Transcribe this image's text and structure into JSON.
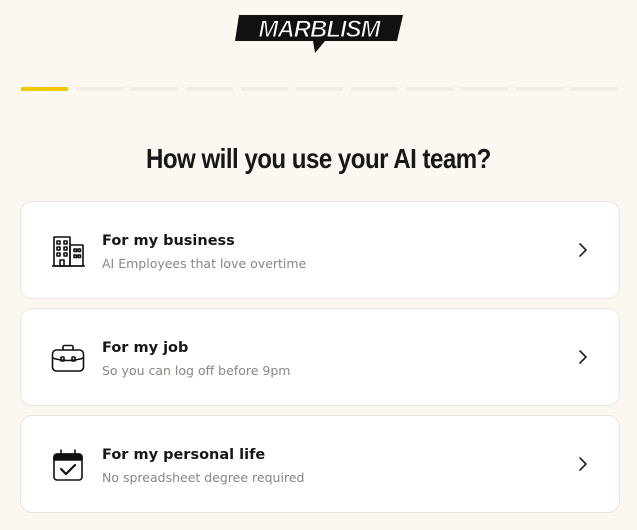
{
  "brand": {
    "logo_text": "MARBLISM"
  },
  "progress": {
    "current_step": 1,
    "total_steps": 11,
    "active_color": "#f0c800"
  },
  "question": {
    "title": "How will you use your AI team?"
  },
  "options": [
    {
      "icon": "building-icon",
      "label": "For my business",
      "description": "AI Employees that love overtime"
    },
    {
      "icon": "briefcase-icon",
      "label": "For my job",
      "description": "So you can log off before 9pm"
    },
    {
      "icon": "calendar-check-icon",
      "label": "For my personal life",
      "description": "No spreadsheet degree required"
    }
  ]
}
